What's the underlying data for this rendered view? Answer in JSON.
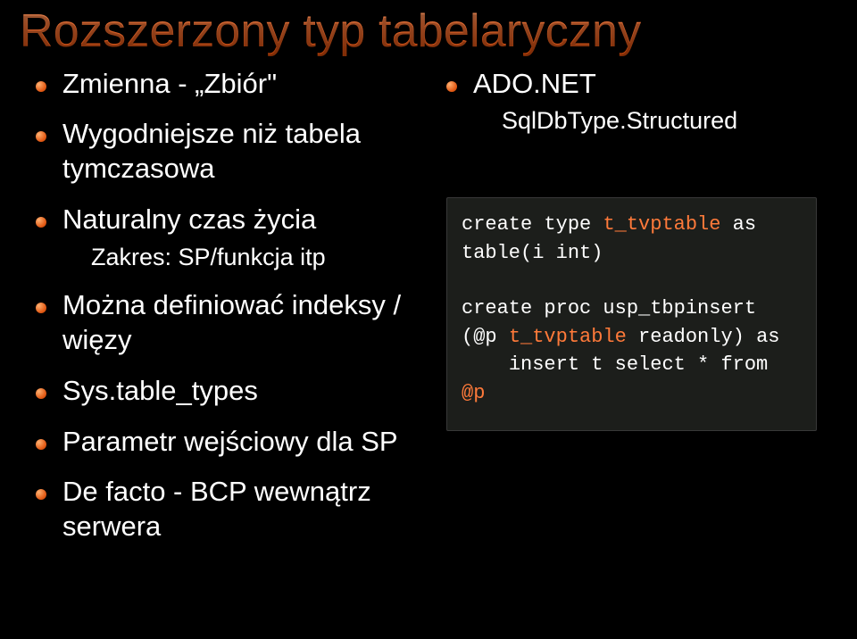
{
  "title": "Rozszerzony typ tabelaryczny",
  "left": {
    "b0": "Zmienna - „Zbiór\"",
    "b1": "Wygodniejsze niż tabela tymczasowa",
    "b2": "Naturalny czas życia",
    "b2s": "Zakres: SP/funkcja itp",
    "b3": "Można definiować indeksy / więzy",
    "b4": "Sys.table_types",
    "b5": "Parametr wejściowy dla SP",
    "b6": "De facto - BCP wewnątrz serwera"
  },
  "right": {
    "b0": "ADO.NET",
    "b0s": "SqlDbType.Structured"
  },
  "code": {
    "l1a": "create type ",
    "l1b": "t_tvptable",
    "l1c": " as",
    "l2": "table(i int)",
    "blank": " ",
    "l3": "create proc usp_tbpinsert",
    "l4a": "(@p ",
    "l4b": "t_tvptable",
    "l4c": " readonly) as",
    "l5a": "    insert t select * from ",
    "l5b": "@p"
  }
}
